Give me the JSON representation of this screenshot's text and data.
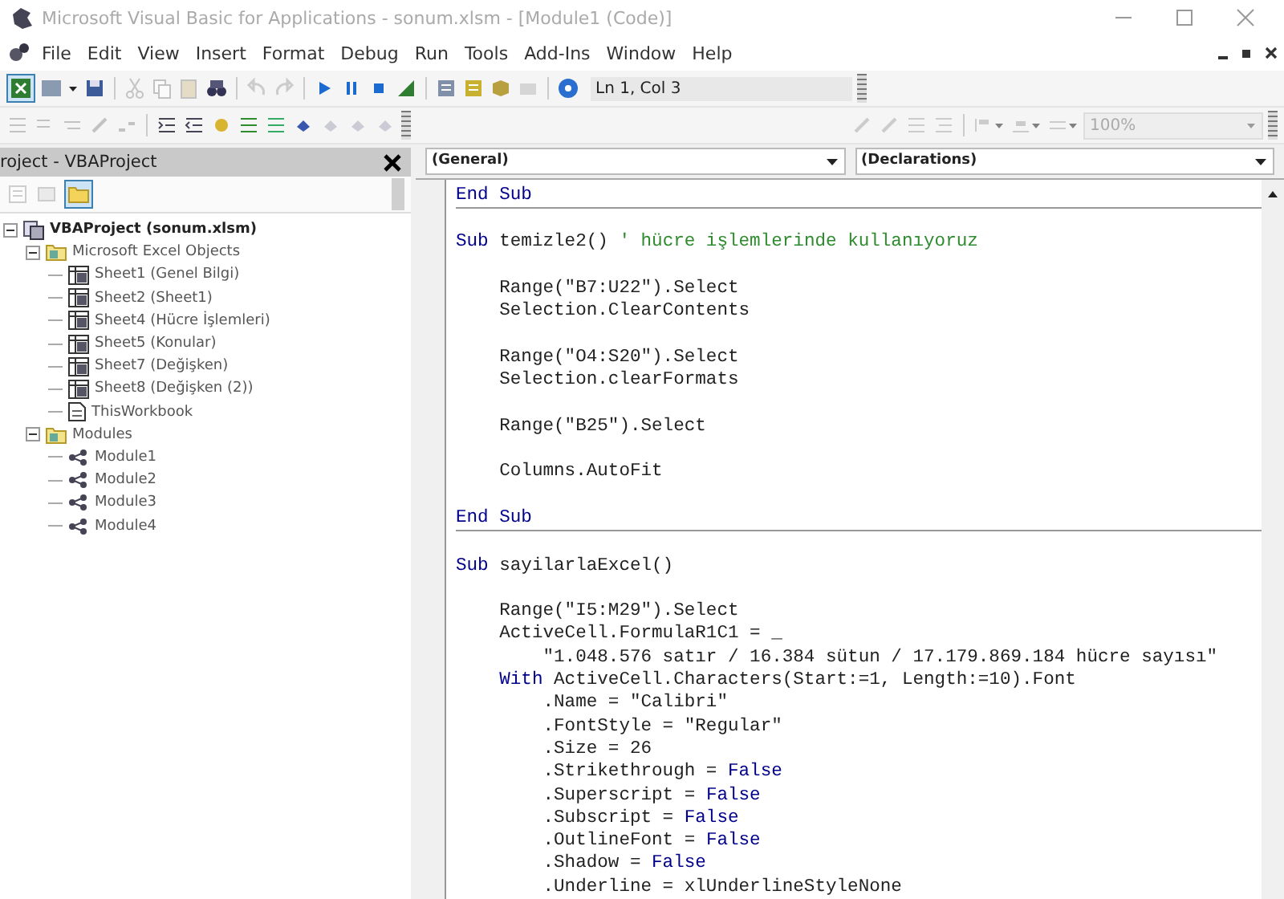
{
  "window": {
    "title": "Microsoft Visual Basic for Applications - sonum.xlsm - [Module1 (Code)]"
  },
  "menu": [
    "File",
    "Edit",
    "View",
    "Insert",
    "Format",
    "Debug",
    "Run",
    "Tools",
    "Add-Ins",
    "Window",
    "Help"
  ],
  "toolbar": {
    "position": "Ln 1, Col 3",
    "zoom": "100%"
  },
  "project": {
    "title": "roject - VBAProject",
    "toggle_folders": {
      "selected": true
    },
    "tree": [
      {
        "label": "VBAProject (sonum.xlsm)",
        "kind": "project",
        "expanded": true,
        "children": [
          {
            "label": "Microsoft Excel Objects",
            "kind": "folder",
            "expanded": true,
            "children": [
              {
                "label": "Sheet1 (Genel Bilgi)",
                "kind": "sheet"
              },
              {
                "label": "Sheet2 (Sheet1)",
                "kind": "sheet"
              },
              {
                "label": "Sheet4 (Hücre İşlemleri)",
                "kind": "sheet"
              },
              {
                "label": "Sheet5 (Konular)",
                "kind": "sheet"
              },
              {
                "label": "Sheet7 (Değişken)",
                "kind": "sheet"
              },
              {
                "label": "Sheet8 (Değişken (2))",
                "kind": "sheet"
              },
              {
                "label": "ThisWorkbook",
                "kind": "workbook"
              }
            ]
          },
          {
            "label": "Modules",
            "kind": "folder",
            "expanded": true,
            "children": [
              {
                "label": "Module1",
                "kind": "module"
              },
              {
                "label": "Module2",
                "kind": "module"
              },
              {
                "label": "Module3",
                "kind": "module"
              },
              {
                "label": "Module4",
                "kind": "module"
              }
            ]
          }
        ]
      }
    ]
  },
  "code": {
    "object": "(General)",
    "procedure": "(Declarations)",
    "procedures": [
      {
        "lines": [
          {
            "kind": "code",
            "tokens": [
              {
                "kind": "keyword",
                "text": "End Sub"
              }
            ]
          }
        ]
      },
      {
        "lines": [
          {
            "kind": "blank"
          },
          {
            "kind": "code",
            "tokens": [
              {
                "kind": "keyword",
                "text": "Sub"
              },
              {
                "kind": "plain",
                "text": " temizle2() "
              },
              {
                "kind": "comment",
                "text": "' hücre işlemlerinde kullanıyoruz"
              }
            ]
          },
          {
            "kind": "blank"
          },
          {
            "kind": "code",
            "tokens": [
              {
                "kind": "plain",
                "text": "    Range(\"B7:U22\").Select"
              }
            ]
          },
          {
            "kind": "code",
            "tokens": [
              {
                "kind": "plain",
                "text": "    Selection.ClearContents"
              }
            ]
          },
          {
            "kind": "blank"
          },
          {
            "kind": "code",
            "tokens": [
              {
                "kind": "plain",
                "text": "    Range(\"O4:S20\").Select"
              }
            ]
          },
          {
            "kind": "code",
            "tokens": [
              {
                "kind": "plain",
                "text": "    Selection.clearFormats"
              }
            ]
          },
          {
            "kind": "blank"
          },
          {
            "kind": "code",
            "tokens": [
              {
                "kind": "plain",
                "text": "    Range(\"B25\").Select"
              }
            ]
          },
          {
            "kind": "blank"
          },
          {
            "kind": "code",
            "tokens": [
              {
                "kind": "plain",
                "text": "    Columns.AutoFit"
              }
            ]
          },
          {
            "kind": "blank"
          },
          {
            "kind": "code",
            "tokens": [
              {
                "kind": "keyword",
                "text": "End Sub"
              }
            ]
          }
        ]
      },
      {
        "lines": [
          {
            "kind": "blank"
          },
          {
            "kind": "code",
            "tokens": [
              {
                "kind": "keyword",
                "text": "Sub"
              },
              {
                "kind": "plain",
                "text": " sayilarlaExcel()"
              }
            ]
          },
          {
            "kind": "blank"
          },
          {
            "kind": "code",
            "tokens": [
              {
                "kind": "plain",
                "text": "    Range(\"I5:M29\").Select"
              }
            ]
          },
          {
            "kind": "code",
            "tokens": [
              {
                "kind": "plain",
                "text": "    ActiveCell.FormulaR1C1 = _"
              }
            ]
          },
          {
            "kind": "code",
            "tokens": [
              {
                "kind": "plain",
                "text": "        \"1.048.576 satır / 16.384 sütun / 17.179.869.184 hücre sayısı\""
              }
            ]
          },
          {
            "kind": "code",
            "tokens": [
              {
                "kind": "keyword",
                "text": "    With"
              },
              {
                "kind": "plain",
                "text": " ActiveCell.Characters(Start:=1, Length:=10).Font"
              }
            ]
          },
          {
            "kind": "code",
            "tokens": [
              {
                "kind": "plain",
                "text": "        .Name = \"Calibri\""
              }
            ]
          },
          {
            "kind": "code",
            "tokens": [
              {
                "kind": "plain",
                "text": "        .FontStyle = \"Regular\""
              }
            ]
          },
          {
            "kind": "code",
            "tokens": [
              {
                "kind": "plain",
                "text": "        .Size = 26"
              }
            ]
          },
          {
            "kind": "code",
            "tokens": [
              {
                "kind": "plain",
                "text": "        .Strikethrough = "
              },
              {
                "kind": "keyword",
                "text": "False"
              }
            ]
          },
          {
            "kind": "code",
            "tokens": [
              {
                "kind": "plain",
                "text": "        .Superscript = "
              },
              {
                "kind": "keyword",
                "text": "False"
              }
            ]
          },
          {
            "kind": "code",
            "tokens": [
              {
                "kind": "plain",
                "text": "        .Subscript = "
              },
              {
                "kind": "keyword",
                "text": "False"
              }
            ]
          },
          {
            "kind": "code",
            "tokens": [
              {
                "kind": "plain",
                "text": "        .OutlineFont = "
              },
              {
                "kind": "keyword",
                "text": "False"
              }
            ]
          },
          {
            "kind": "code",
            "tokens": [
              {
                "kind": "plain",
                "text": "        .Shadow = "
              },
              {
                "kind": "keyword",
                "text": "False"
              }
            ]
          },
          {
            "kind": "code",
            "tokens": [
              {
                "kind": "plain",
                "text": "        .Underline = xlUnderlineStyleNone"
              }
            ]
          }
        ]
      }
    ]
  }
}
